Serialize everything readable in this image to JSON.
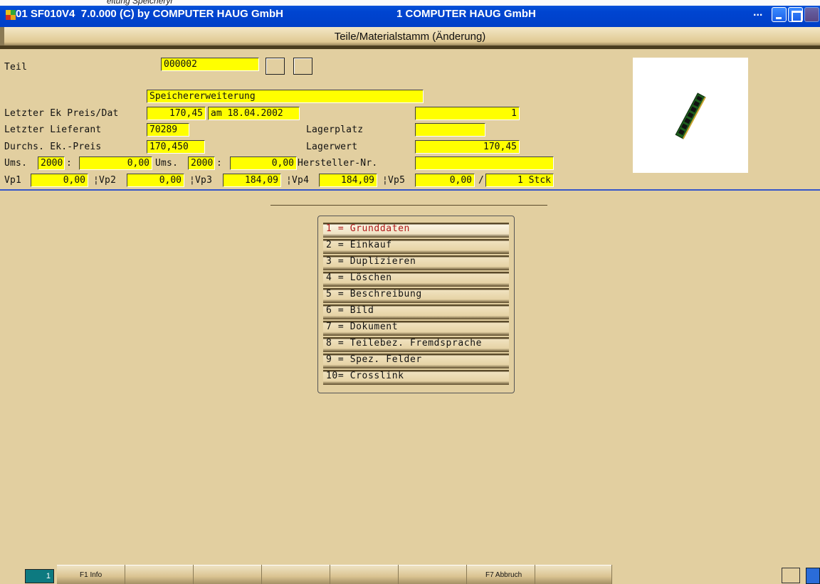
{
  "window": {
    "top_strip_text": "eitung Speicheryr",
    "title_left": "01 SF010V4  7.0.000 (C) by COMPUTER HAUG GmbH",
    "title_center": "1 COMPUTER HAUG GmbH",
    "title_ellipsis": "..."
  },
  "header": {
    "title": "Teile/Materialstamm (Änderung)"
  },
  "form": {
    "teil_label": "Teil",
    "teil_value": "000002",
    "description": "Speichererweiterung",
    "ek_label": "Letzter Ek Preis/Dat",
    "ek_price": "170,45",
    "ek_date": "am 18.04.2002",
    "right_top_value": "1",
    "lieferant_label": "Letzter Lieferant",
    "lieferant_value": "70289",
    "lagerplatz_label": "Lagerplatz",
    "lagerplatz_value": "",
    "durchs_label": "Durchs. Ek.-Preis",
    "durchs_value": "170,450",
    "lagerwert_label": "Lagerwert",
    "lagerwert_value": "170,45",
    "ums1_label": "Ums.",
    "ums1_year": "2000",
    "colon": ":",
    "ums1_value": "0,00",
    "ums2_label": "Ums.",
    "ums2_year": "2000",
    "ums2_value": "0,00",
    "hersteller_label": "Hersteller-Nr.",
    "hersteller_value": "",
    "vp1_label": "Vp1",
    "vp1_value": "0,00",
    "vp2_label": "¦Vp2",
    "vp2_value": "0,00",
    "vp3_label": "¦Vp3",
    "vp3_value": "184,09",
    "vp4_label": "¦Vp4",
    "vp4_value": "184,09",
    "vp5_label": "¦Vp5",
    "vp5_value": "0,00",
    "slash": "/",
    "unit_value": "1 Stck"
  },
  "menu": {
    "items": [
      {
        "label": "1 = Grunddaten"
      },
      {
        "label": "2 = Einkauf"
      },
      {
        "label": "3 = Duplizieren"
      },
      {
        "label": "4 = Löschen"
      },
      {
        "label": "5 = Beschreibung"
      },
      {
        "label": "6 = Bild"
      },
      {
        "label": "7 = Dokument"
      },
      {
        "label": "8 = Teilebez. Fremdsprache"
      },
      {
        "label": "9 = Spez. Felder"
      },
      {
        "label": "10= Crosslink"
      }
    ],
    "selected_index": 0
  },
  "footer": {
    "page_number": "1",
    "fkeys": [
      "F1 Info",
      "",
      "",
      "",
      "",
      "",
      "F7 Abbruch",
      ""
    ]
  }
}
